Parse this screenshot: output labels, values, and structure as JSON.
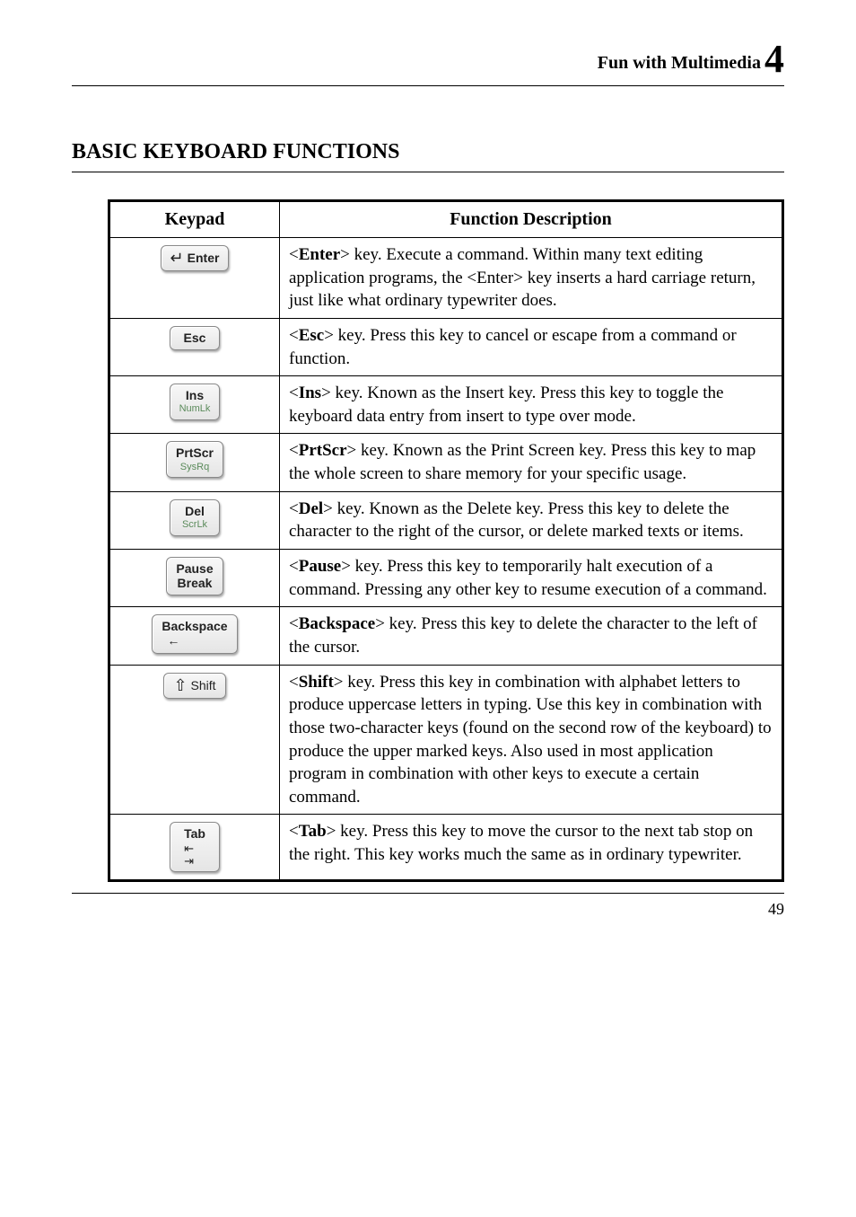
{
  "header": {
    "label": "Fun with Multimedia",
    "number": "4"
  },
  "section_title_big1": "B",
  "section_title_rest1": "ASIC",
  "section_title_big2": "K",
  "section_title_rest2": "EYBOARD",
  "section_title_big3": "F",
  "section_title_rest3": "UNCTIONS",
  "table": {
    "head_keypad": "Keypad",
    "head_desc": "Function Description",
    "rows": [
      {
        "key_primary": "Enter",
        "key_glyph": "↵",
        "desc_bold": "Enter",
        "desc_rest": "> key. Execute a command. Within many text editing application programs, the <Enter> key inserts a hard carriage return, just like what ordinary typewriter does."
      },
      {
        "key_primary": "Esc",
        "desc_bold": "Esc",
        "desc_rest": "> key. Press this key to cancel or escape from a command or function."
      },
      {
        "key_primary": "Ins",
        "key_secondary": "NumLk",
        "desc_bold": "Ins",
        "desc_rest": "> key. Known as the Insert key. Press this key to toggle the keyboard data entry from insert to type over mode."
      },
      {
        "key_primary": "PrtScr",
        "key_secondary": "SysRq",
        "desc_bold": "PrtScr",
        "desc_rest": "> key. Known as the Print Screen key. Press this key to map the whole screen to share memory for your specific usage."
      },
      {
        "key_primary": "Del",
        "key_secondary": "ScrLk",
        "desc_bold": "Del",
        "desc_rest": "> key. Known as the Delete key. Press this key to delete the character to the right of the cursor, or delete marked texts or items."
      },
      {
        "key_primary": "Pause",
        "key_secondary_bold": "Break",
        "desc_bold": "Pause",
        "desc_rest": "> key. Press this key to temporarily halt execution of a command. Pressing any other key to resume execution of a command."
      },
      {
        "key_primary": "Backspace",
        "key_sub_glyph": "←",
        "desc_bold": "Backspace",
        "desc_rest": "> key. Press this key to delete the character to the left of the cursor."
      },
      {
        "key_primary": "Shift",
        "key_glyph": "⇧",
        "desc_bold": "Shift",
        "desc_rest": "> key. Press this key in combination with alphabet letters to produce uppercase letters in typing. Use this key in combination with those two-character keys (found on the second row of the keyboard) to produce the upper marked keys. Also used in most application program in combination with other keys to execute a certain command."
      },
      {
        "key_primary": "Tab",
        "key_tab_arrows": true,
        "desc_bold": "Tab",
        "desc_rest": "> key. Press this key to move the cursor to the next tab stop on the right. This key works much the same as in ordinary typewriter."
      }
    ]
  },
  "page_number": "49"
}
